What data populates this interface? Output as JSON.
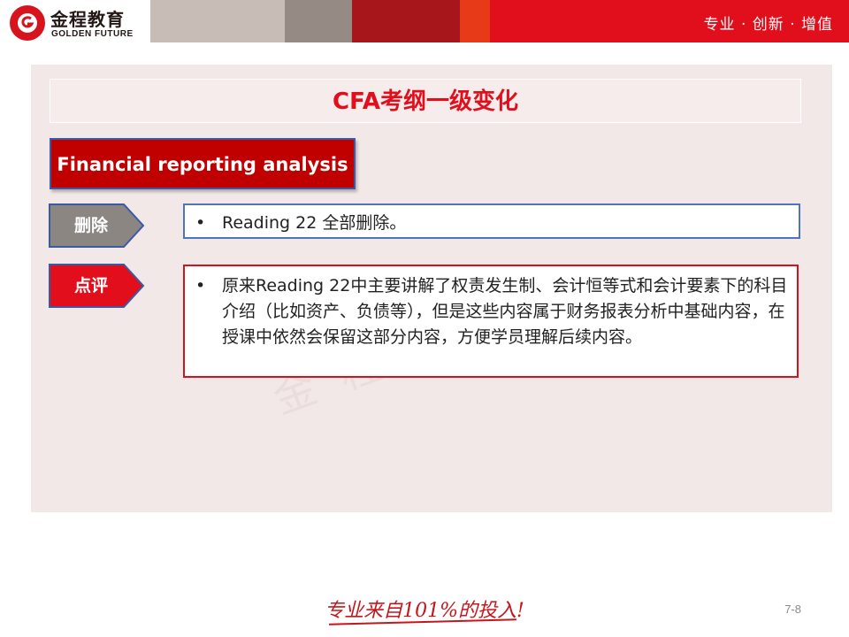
{
  "brand": {
    "logo_name_cn": "金程教育",
    "logo_name_en": "GOLDEN FUTURE",
    "slogan": "专业 · 创新 · 增值",
    "colors": {
      "primary_red": "#e10e1c",
      "dark_red": "#c00000",
      "blue_border": "#4f75b8"
    }
  },
  "slide": {
    "title": "CFA考纲一级变化",
    "section": "Financial reporting analysis",
    "items": [
      {
        "tag": "删除",
        "tag_color": "#8c8683",
        "bullet": "•",
        "text": "Reading 22 全部删除。"
      },
      {
        "tag": "点评",
        "tag_color": "#e30e1b",
        "bullet": "•",
        "text": "原来Reading 22中主要讲解了权责发生制、会计恒等式和会计要素下的科目介绍（比如资产、负债等），但是这些内容属于财务报表分析中基础内容，在授课中依然会保留这部分内容，方便学员理解后续内容。"
      }
    ]
  },
  "footer": {
    "slogan": "专业来自101%的投入!",
    "page_number": "7-8"
  }
}
